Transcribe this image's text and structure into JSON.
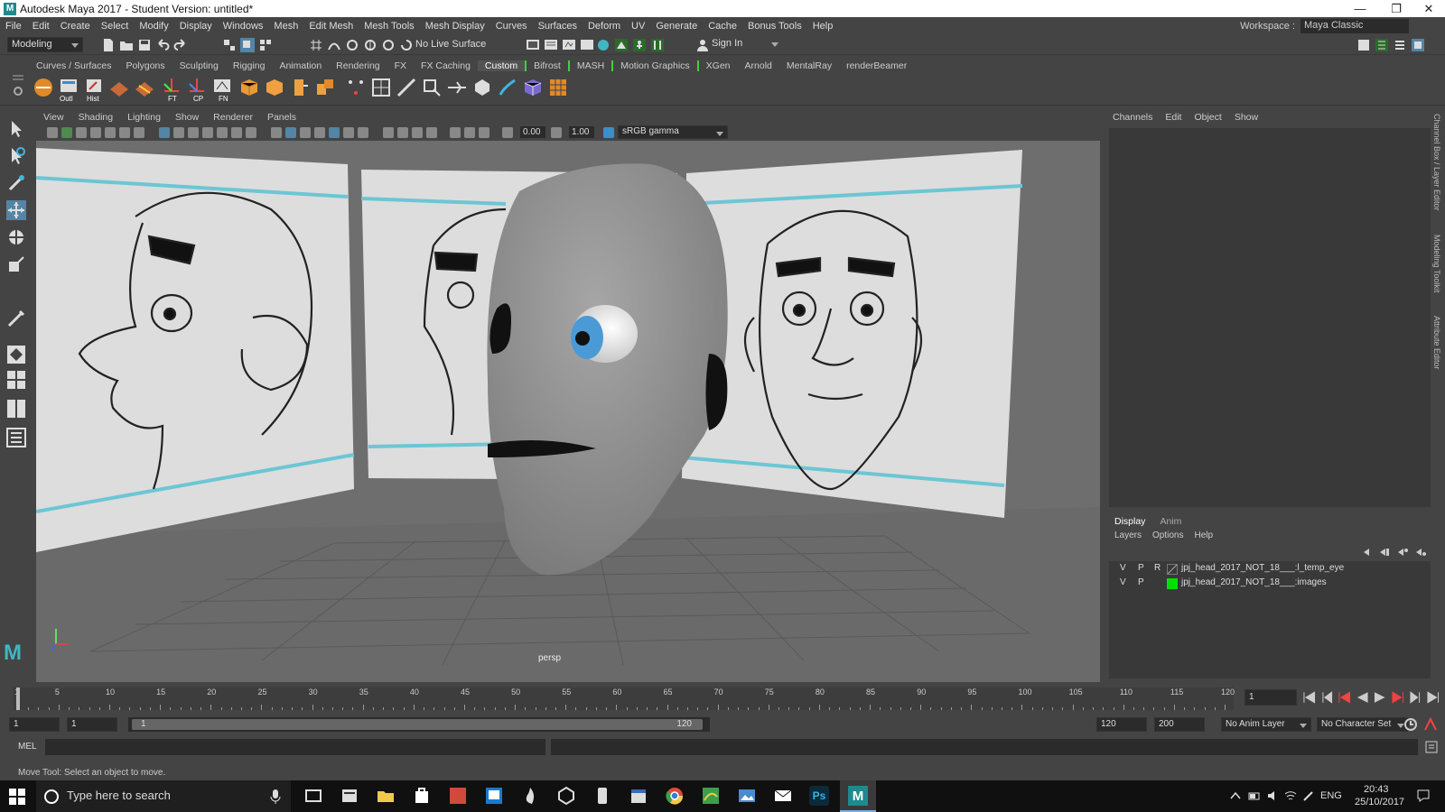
{
  "window": {
    "title": "Autodesk Maya 2017 - Student Version: untitled*"
  },
  "menus": [
    "File",
    "Edit",
    "Create",
    "Select",
    "Modify",
    "Display",
    "Windows",
    "Mesh",
    "Edit Mesh",
    "Mesh Tools",
    "Mesh Display",
    "Curves",
    "Surfaces",
    "Deform",
    "UV",
    "Generate",
    "Cache",
    "Bonus Tools",
    "Help"
  ],
  "workspace": {
    "label": "Workspace :",
    "value": "Maya Classic"
  },
  "statusline": {
    "mode": "Modeling",
    "live_surface": "No Live Surface",
    "sign_in": "Sign In"
  },
  "shelf_tabs": [
    "Curves / Surfaces",
    "Polygons",
    "Sculpting",
    "Rigging",
    "Animation",
    "Rendering",
    "FX",
    "FX Caching",
    "Custom",
    "Bifrost",
    "MASH",
    "Motion Graphics",
    "XGen",
    "Arnold",
    "MentalRay",
    "renderBeamer"
  ],
  "shelf_active": "Custom",
  "shelf_labels": {
    "outl": "Outl",
    "hist": "Hist",
    "ft": "FT",
    "cp": "CP",
    "fn": "FN"
  },
  "viewport": {
    "menus": [
      "View",
      "Shading",
      "Lighting",
      "Show",
      "Renderer",
      "Panels"
    ],
    "exposure": "0.00",
    "gamma": "1.00",
    "color_space": "sRGB gamma",
    "camera": "persp"
  },
  "channel_box": {
    "menus": [
      "Channels",
      "Edit",
      "Object",
      "Show"
    ]
  },
  "side_tabs": [
    "Channel Box / Layer Editor",
    "Modeling Toolkit",
    "Attribute Editor"
  ],
  "layer_editor": {
    "tabs": [
      "Display",
      "Anim"
    ],
    "menus": [
      "Layers",
      "Options",
      "Help"
    ],
    "layers": [
      {
        "v": "V",
        "p": "P",
        "r": "R",
        "name": "jpj_head_2017_NOT_18___:l_temp_eye",
        "color": ""
      },
      {
        "v": "V",
        "p": "P",
        "r": "",
        "name": "jpj_head_2017_NOT_18___:images",
        "color": "#00e000"
      }
    ]
  },
  "timeline": {
    "ticks": [
      "1",
      "5",
      "10",
      "15",
      "20",
      "25",
      "30",
      "35",
      "40",
      "45",
      "50",
      "55",
      "60",
      "65",
      "70",
      "75",
      "80",
      "85",
      "90",
      "95",
      "100",
      "105",
      "110",
      "115",
      "120"
    ],
    "current_frame": "1"
  },
  "range": {
    "start": "1",
    "playback_start": "1",
    "slider_start": "1",
    "slider_end": "120",
    "playback_end": "120",
    "end": "200",
    "anim_layer": "No Anim Layer",
    "char_set": "No Character Set"
  },
  "mel": {
    "label": "MEL"
  },
  "help_line": "Move Tool: Select an object to move.",
  "taskbar": {
    "search": "Type here to search",
    "lang": "ENG",
    "time": "20:43",
    "date": "25/10/2017",
    "ps": "Ps"
  }
}
